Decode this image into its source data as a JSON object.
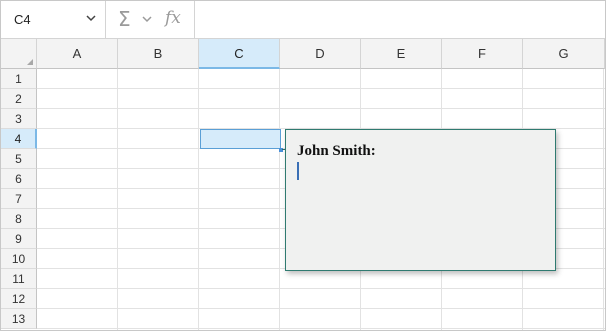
{
  "formula_bar": {
    "name_box": "C4",
    "sigma_symbol": "Σ",
    "fx_symbol": "fx",
    "formula_value": ""
  },
  "columns": [
    "A",
    "B",
    "C",
    "D",
    "E",
    "F",
    "G"
  ],
  "rows": [
    "1",
    "2",
    "3",
    "4",
    "5",
    "6",
    "7",
    "8",
    "9",
    "10",
    "11",
    "12",
    "13"
  ],
  "selection": {
    "column": "C",
    "row": "4"
  },
  "comment": {
    "author": "John Smith:",
    "text": ""
  },
  "colors": {
    "accent": "#5a9fd6",
    "header_active": "#d6ebfa",
    "comment_border": "#2f7a70",
    "comment_bg": "#f0f1f0"
  },
  "icons": {
    "name_box_dropdown": "chevron-down-icon",
    "sum": "sigma-icon",
    "sum_dropdown": "chevron-down-icon",
    "function": "fx-icon"
  }
}
